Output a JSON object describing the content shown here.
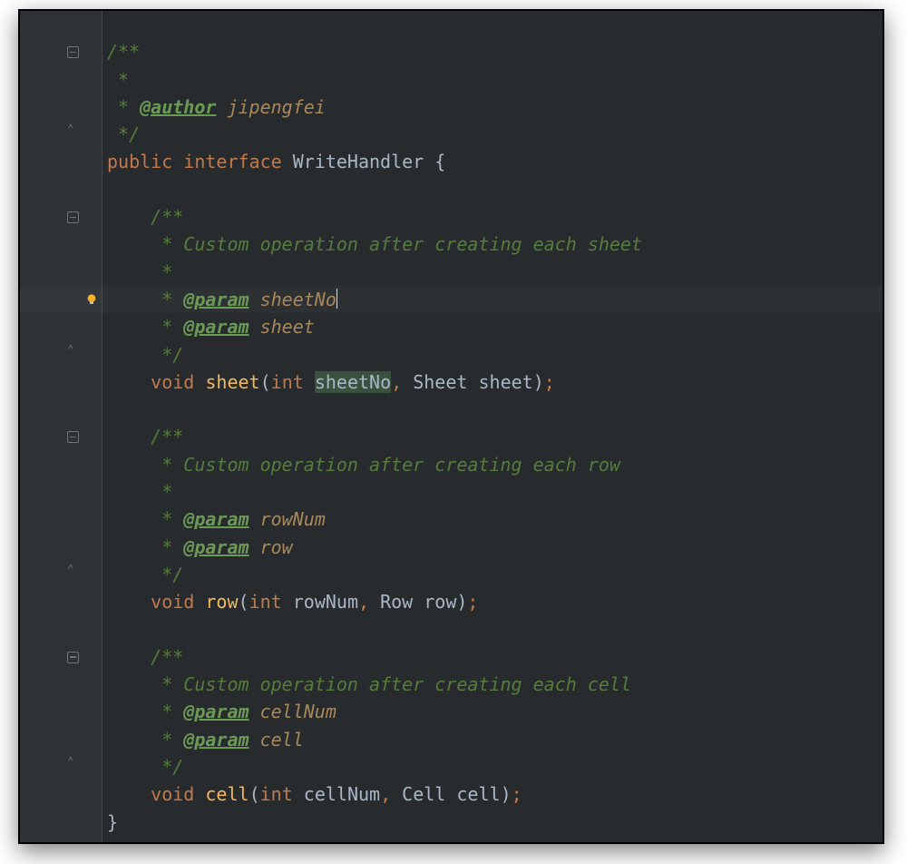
{
  "doc": {
    "open": "/**",
    "star": " *",
    "author_tag": "@author",
    "author_name": "jipengfei",
    "close": " */"
  },
  "class_line": {
    "kw_public": "public",
    "kw_interface": "interface",
    "name": "WriteHandler",
    "brace_open": "{"
  },
  "sheet": {
    "doc_open": "/**",
    "doc_desc": " * Custom operation after creating each sheet",
    "doc_star": " *",
    "param_tag": "@param",
    "param1": "sheetNo",
    "param2": "sheet",
    "doc_close": " */",
    "ret": "void",
    "name": "sheet",
    "p1_type": "int",
    "p1_name": "sheetNo",
    "p2_type": "Sheet",
    "p2_name": "sheet"
  },
  "row": {
    "doc_open": "/**",
    "doc_desc": " * Custom operation after creating each row",
    "doc_star": " *",
    "param_tag": "@param",
    "param1": "rowNum",
    "param2": "row",
    "doc_close": " */",
    "ret": "void",
    "name": "row",
    "p1_type": "int",
    "p1_name": "rowNum",
    "p2_type": "Row",
    "p2_name": "row"
  },
  "cell": {
    "doc_open": "/**",
    "doc_desc": " * Custom operation after creating each cell",
    "param_tag": "@param",
    "param1": "cellNum",
    "param2": "cell",
    "doc_close": " */",
    "ret": "void",
    "name": "cell",
    "p1_type": "int",
    "p1_name": "cellNum",
    "p2_type": "Cell",
    "p2_name": "cell"
  },
  "close_brace": "}",
  "punct": {
    "semi": ";",
    "comma": ",",
    "lparen": "(",
    "rparen": ")"
  }
}
